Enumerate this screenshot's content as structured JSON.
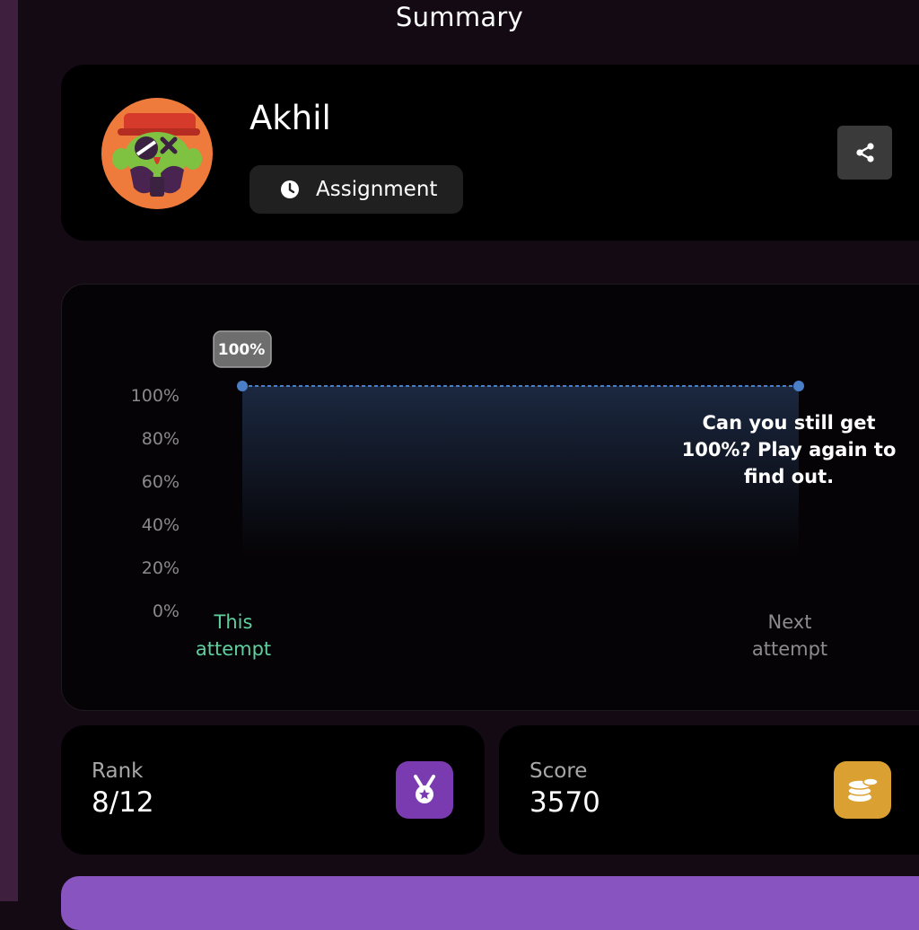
{
  "page": {
    "title": "Summary"
  },
  "profile": {
    "name": "Akhil",
    "mode_label": "Assignment",
    "avatar_icon": "monster-avatar-icon",
    "share_icon": "share-icon"
  },
  "chart_data": {
    "type": "line",
    "categories": [
      "This attempt",
      "Next attempt"
    ],
    "values": [
      100,
      100
    ],
    "value_label": "100%",
    "y_ticks": [
      "0%",
      "20%",
      "40%",
      "60%",
      "80%",
      "100%"
    ],
    "ylim": [
      0,
      100
    ],
    "message": "Can you still get 100%? Play again to find out.",
    "colors": {
      "line": "#4a7ec7",
      "this_attempt": "#5fd0a0",
      "next_attempt": "#8c8c8c"
    }
  },
  "stats": {
    "rank": {
      "label": "Rank",
      "value": "8/12",
      "icon": "medal-icon"
    },
    "score": {
      "label": "Score",
      "value": "3570",
      "icon": "coins-icon"
    }
  }
}
